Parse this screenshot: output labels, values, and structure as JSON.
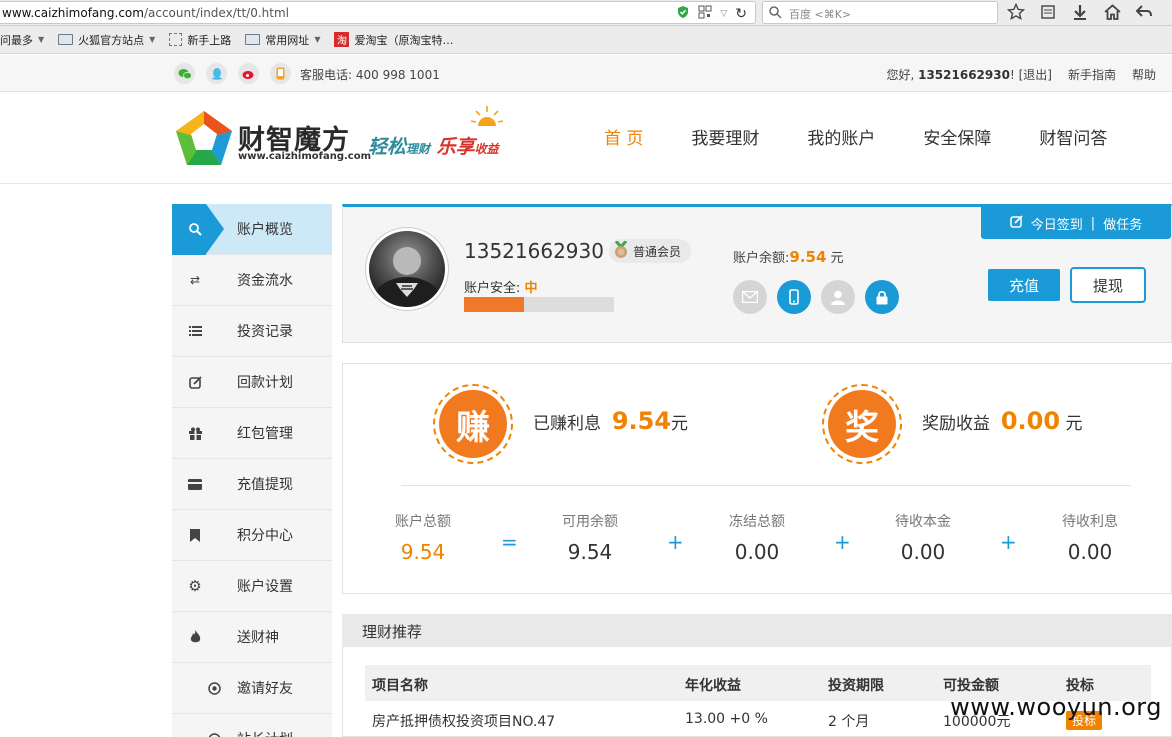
{
  "browser": {
    "url_host": "www.caizhimofang.com",
    "url_path": "/account/index/tt/0.html",
    "search_placeholder": "百度 <⌘K>",
    "bookmarks": [
      "问最多",
      "火狐官方站点",
      "新手上路",
      "常用网址",
      "爱淘宝（原淘宝特…"
    ]
  },
  "topbar": {
    "hotline": "客服电话: 400 998 1001",
    "greeting": "您好,",
    "username": "13521662930",
    "logout": "[退出]",
    "guide": "新手指南",
    "help": "帮助"
  },
  "brand": {
    "name": "财智魔方",
    "url": "www.caizhimofang.com",
    "slogan_a": "轻松",
    "slogan_a_small": "理财",
    "slogan_b": "乐享",
    "slogan_b_small": "收益"
  },
  "nav": [
    "首 页",
    "我要理财",
    "我的账户",
    "安全保障",
    "财智问答"
  ],
  "sidebar": [
    {
      "label": "账户概览",
      "icon": "search-icon"
    },
    {
      "label": "资金流水",
      "icon": "transfer-icon"
    },
    {
      "label": "投资记录",
      "icon": "list-icon"
    },
    {
      "label": "回款计划",
      "icon": "edit-icon"
    },
    {
      "label": "红包管理",
      "icon": "gift-icon"
    },
    {
      "label": "充值提现",
      "icon": "card-icon"
    },
    {
      "label": "积分中心",
      "icon": "bookmark-icon"
    },
    {
      "label": "账户设置",
      "icon": "gear-icon"
    },
    {
      "label": "送财神",
      "icon": "fire-icon"
    },
    {
      "label": "邀请好友",
      "icon": "circle-dot-icon"
    },
    {
      "label": "站长计划",
      "icon": "circle-dot-icon"
    }
  ],
  "account": {
    "phone": "13521662930",
    "member_level": "普通会员",
    "security_label": "账户安全:",
    "security_level": "中",
    "security_progress": 0.4,
    "balance_label": "账户余额:",
    "balance_value": "9.54",
    "balance_unit": "元",
    "signin": "今日签到",
    "task": "做任务",
    "charge": "充值",
    "withdraw": "提现"
  },
  "earnings": {
    "earned_badge": "赚",
    "earned_label": "已赚利息",
    "earned_value": "9.54",
    "earned_unit": "元",
    "reward_badge": "奖",
    "reward_label": "奖励收益",
    "reward_value": "0.00",
    "reward_unit": "元"
  },
  "stats": [
    {
      "label": "账户总额",
      "value": "9.54"
    },
    {
      "label": "可用余额",
      "value": "9.54"
    },
    {
      "label": "冻结总额",
      "value": "0.00"
    },
    {
      "label": "待收本金",
      "value": "0.00"
    },
    {
      "label": "待收利息",
      "value": "0.00"
    }
  ],
  "ops": [
    "=",
    "+",
    "+",
    "+"
  ],
  "recommend": {
    "title": "理财推荐",
    "headers": [
      "项目名称",
      "年化收益",
      "投资期限",
      "可投金额",
      "投标"
    ],
    "row": {
      "name": "房产抵押债权投资项目NO.47",
      "rate": "13.00 +0 %",
      "term": "2 个月",
      "amount": "100000元",
      "action": "投标"
    }
  },
  "watermark": "www.wooyun.org",
  "colors": {
    "accent": "#1a9ad6",
    "orange": "#f08300"
  }
}
